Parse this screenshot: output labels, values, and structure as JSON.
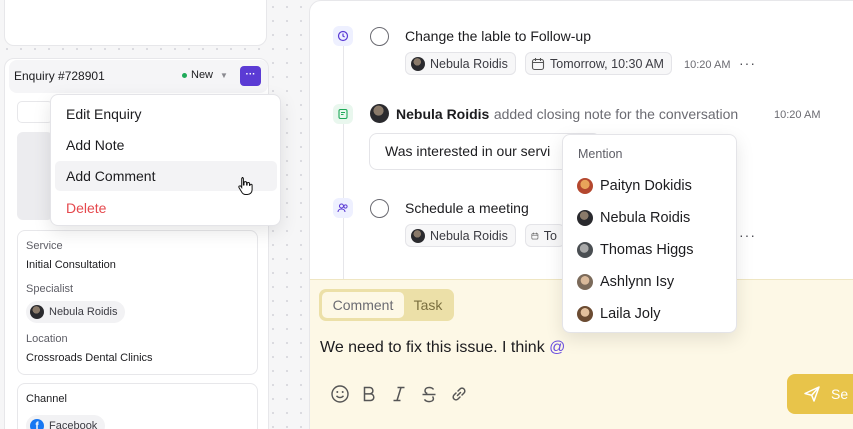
{
  "enquiry": {
    "title": "Enquiry #728901",
    "status": "New",
    "more_label": "···"
  },
  "context_menu": {
    "items": [
      "Edit Enquiry",
      "Add Note",
      "Add Comment",
      "Delete"
    ]
  },
  "info": {
    "service_label": "Service",
    "service_value": "Initial Consultation",
    "specialist_label": "Specialist",
    "specialist_value": "Nebula Roidis",
    "location_label": "Location",
    "location_value": "Crossroads Dental Clinics",
    "channel_label": "Channel",
    "channel_value": "Facebook"
  },
  "timeline": {
    "task1": {
      "title": "Change the lable to Follow-up",
      "assignee": "Nebula Roidis",
      "due": "Tomorrow, 10:30 AM",
      "time": "10:20 AM",
      "more": "···"
    },
    "note": {
      "author": "Nebula Roidis",
      "action": "added closing note for the conversation",
      "time": "10:20 AM",
      "text": "Was interested in our servi"
    },
    "task2": {
      "title": "Schedule a meeting",
      "assignee": "Nebula Roidis",
      "due": "To",
      "more": "···"
    }
  },
  "composer": {
    "tab_comment": "Comment",
    "tab_task": "Task",
    "text": "We need to fix this issue. I think ",
    "mention_trigger": "@",
    "send_label": "Se"
  },
  "mention_menu": {
    "header": "Mention",
    "people": [
      "Paityn Dokidis",
      "Nebula Roidis",
      "Thomas Higgs",
      "Ashlynn Isy",
      "Laila Joly"
    ]
  },
  "colors": {
    "accent": "#5b3bd4",
    "danger": "#e5484d",
    "composer_bg": "#fdf8e6",
    "send_button": "#e8c44a"
  }
}
